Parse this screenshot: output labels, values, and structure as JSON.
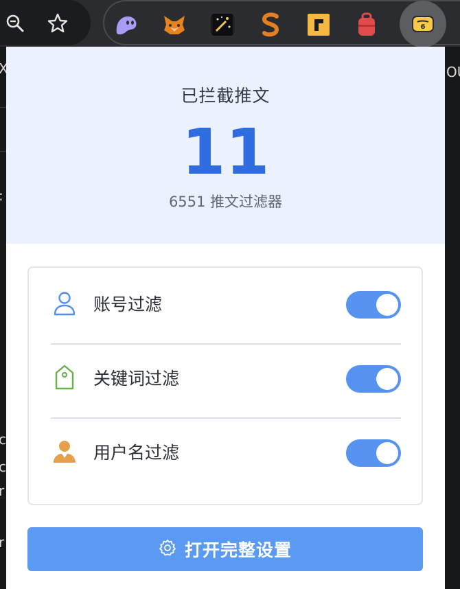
{
  "browser": {
    "toolbar_icons": [
      "zoom-icon",
      "bookmark-star-icon"
    ],
    "extensions": [
      {
        "name": "phantom-ghost-icon",
        "color": "#a99cf5"
      },
      {
        "name": "metamask-fox-icon",
        "color": "#e8821e"
      },
      {
        "name": "magic-wand-icon",
        "color": "#f2c94c"
      },
      {
        "name": "s-logo-icon",
        "color": "#e67e22"
      },
      {
        "name": "r-logo-icon",
        "color": "#f5b942"
      },
      {
        "name": "backpack-icon",
        "color": "#e24b4b"
      },
      {
        "name": "tweet-filter-extension-icon",
        "color": "#f7c948",
        "active": true
      }
    ]
  },
  "popup": {
    "stats": {
      "title": "已拦截推文",
      "count": "11",
      "subtitle": "6551 推文过滤器"
    },
    "filters": [
      {
        "label": "账号过滤",
        "icon": "user-outline-icon",
        "enabled": true
      },
      {
        "label": "关键词过滤",
        "icon": "tag-icon",
        "enabled": true
      },
      {
        "label": "用户名过滤",
        "icon": "person-filled-icon",
        "enabled": true
      }
    ],
    "open_settings": {
      "label": "打开完整设置",
      "icon": "gear-icon"
    }
  },
  "colors": {
    "accent": "#2e6ce0",
    "toggle_on": "#5693f0",
    "button": "#5b9af2",
    "stats_bg": "#ebf2fe"
  }
}
